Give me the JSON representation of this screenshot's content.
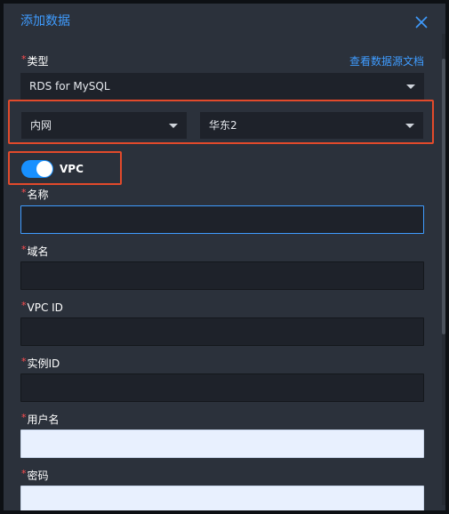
{
  "dialog": {
    "title": "添加数据",
    "close_icon": "close-icon"
  },
  "form": {
    "type": {
      "required_mark": "*",
      "label": "类型",
      "value": "RDS for MySQL"
    },
    "doc_link": "查看数据源文档",
    "network": {
      "value": "内网"
    },
    "region": {
      "value": "华东2"
    },
    "vpc": {
      "label": "VPC",
      "enabled": true
    },
    "name": {
      "required_mark": "*",
      "label": "名称",
      "value": ""
    },
    "domain": {
      "required_mark": "*",
      "label": "域名",
      "value": ""
    },
    "vpc_id": {
      "required_mark": "*",
      "label": "VPC ID",
      "value": ""
    },
    "instance_id": {
      "required_mark": "*",
      "label": "实例ID",
      "value": ""
    },
    "username": {
      "required_mark": "*",
      "label": "用户名",
      "value": ""
    },
    "password": {
      "required_mark": "*",
      "label": "密码",
      "value": ""
    }
  },
  "colors": {
    "accent": "#3f9cff",
    "highlight": "#e24a2b",
    "toggle_on": "#1890ff"
  }
}
